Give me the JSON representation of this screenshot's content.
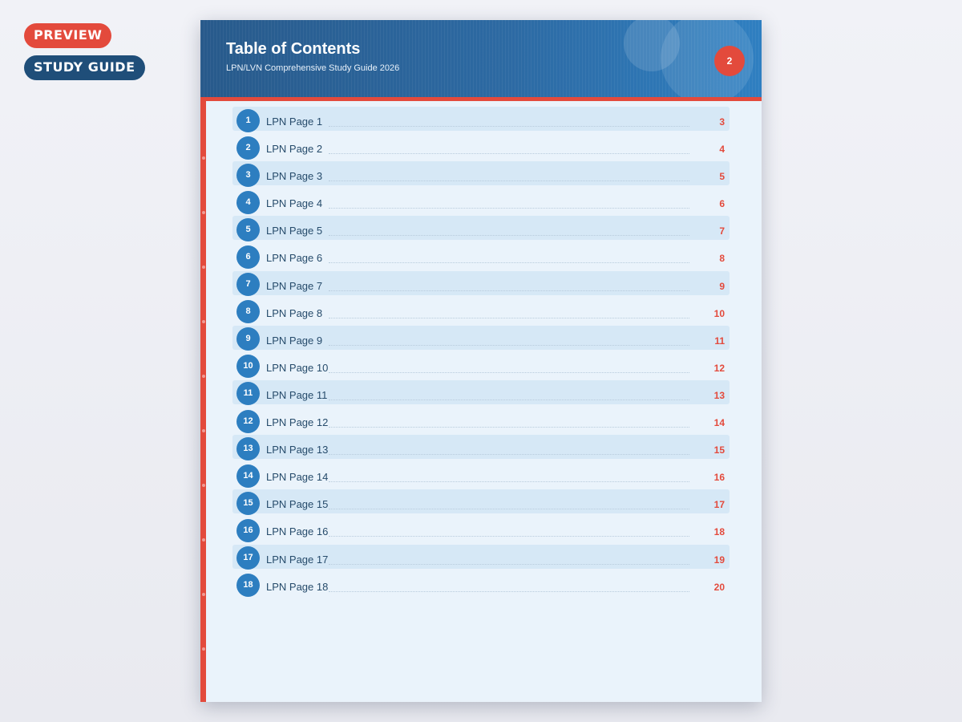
{
  "badges": {
    "preview": "PREVIEW",
    "study_guide": "STUDY GUIDE"
  },
  "header": {
    "title": "Table of Contents",
    "subtitle": "LPN/LVN Comprehensive Study Guide 2026",
    "page_number": "2"
  },
  "colors": {
    "accent_red": "#e34a3c",
    "header_blue": "#2d6aa3",
    "circle_blue": "#2d7ec0",
    "row_shade": "#d6e8f6",
    "page_bg": "#eaf3fb"
  },
  "toc": [
    {
      "num": "1",
      "title": "LPN Page 1",
      "page": "3"
    },
    {
      "num": "2",
      "title": "LPN Page 2",
      "page": "4"
    },
    {
      "num": "3",
      "title": "LPN Page 3",
      "page": "5"
    },
    {
      "num": "4",
      "title": "LPN Page 4",
      "page": "6"
    },
    {
      "num": "5",
      "title": "LPN Page 5",
      "page": "7"
    },
    {
      "num": "6",
      "title": "LPN Page 6",
      "page": "8"
    },
    {
      "num": "7",
      "title": "LPN Page 7",
      "page": "9"
    },
    {
      "num": "8",
      "title": "LPN Page 8",
      "page": "10"
    },
    {
      "num": "9",
      "title": "LPN Page 9",
      "page": "11"
    },
    {
      "num": "10",
      "title": "LPN Page 10",
      "page": "12"
    },
    {
      "num": "11",
      "title": "LPN Page 11",
      "page": "13"
    },
    {
      "num": "12",
      "title": "LPN Page 12",
      "page": "14"
    },
    {
      "num": "13",
      "title": "LPN Page 13",
      "page": "15"
    },
    {
      "num": "14",
      "title": "LPN Page 14",
      "page": "16"
    },
    {
      "num": "15",
      "title": "LPN Page 15",
      "page": "17"
    },
    {
      "num": "16",
      "title": "LPN Page 16",
      "page": "18"
    },
    {
      "num": "17",
      "title": "LPN Page 17",
      "page": "19"
    },
    {
      "num": "18",
      "title": "LPN Page 18",
      "page": "20"
    }
  ]
}
